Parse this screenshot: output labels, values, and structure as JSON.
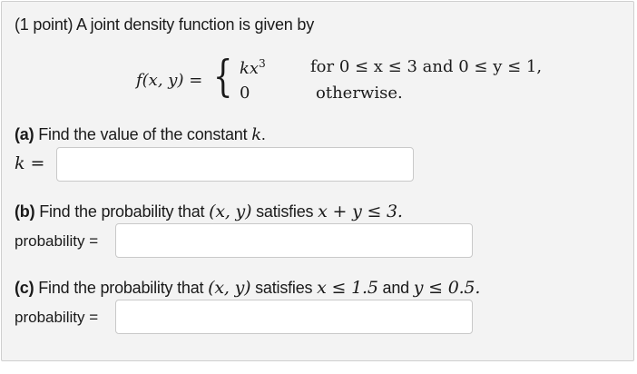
{
  "problem": {
    "intro": "(1 point) A joint density function is given by",
    "function_lhs": "f(x, y) =",
    "case1_expr": "kx",
    "case1_exp": "3",
    "case1_cond": "for 0 ≤ x ≤ 3 and 0 ≤ y ≤ 1,",
    "case2_expr": "0",
    "case2_cond": "otherwise."
  },
  "part_a": {
    "tag": "(a)",
    "text": "Find the value of the constant",
    "var": "k",
    "tail": ".",
    "answer_label": "k =",
    "answer_value": ""
  },
  "part_b": {
    "tag": "(b)",
    "text": "Find the probability that",
    "pair": "(x, y)",
    "mid": "satisfies",
    "cond": "x + y ≤ 3.",
    "answer_label": "probability =",
    "answer_value": ""
  },
  "part_c": {
    "tag": "(c)",
    "text": "Find the probability that",
    "pair": "(x, y)",
    "mid": "satisfies",
    "cond1": "x ≤ 1.5",
    "joiner": "and",
    "cond2": "y ≤ 0.5.",
    "answer_label": "probability =",
    "answer_value": ""
  }
}
